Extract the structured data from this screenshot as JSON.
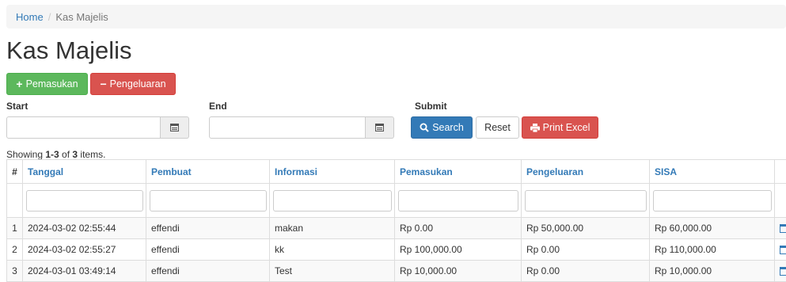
{
  "breadcrumb": {
    "home": "Home",
    "separator": "/",
    "current": "Kas Majelis"
  },
  "page": {
    "title": "Kas Majelis"
  },
  "actions": {
    "pemasukan": "Pemasukan",
    "pengeluaran": "Pengeluaran"
  },
  "filters": {
    "start_label": "Start",
    "end_label": "End",
    "submit_label": "Submit",
    "start_value": "",
    "end_value": "",
    "search": "Search",
    "reset": "Reset",
    "print_excel": "Print Excel"
  },
  "summary": {
    "prefix": "Showing ",
    "range": "1-3",
    "middle": " of ",
    "total": "3",
    "suffix": " items."
  },
  "table": {
    "columns": [
      "#",
      "Tanggal",
      "Pembuat",
      "Informasi",
      "Pemasukan",
      "Pengeluaran",
      "SISA",
      ""
    ],
    "rows": [
      [
        "1",
        "2024-03-02 02:55:44",
        "effendi",
        "makan",
        "Rp 0.00",
        "Rp 50,000.00",
        "Rp 60,000.00"
      ],
      [
        "2",
        "2024-03-02 02:55:27",
        "effendi",
        "kk",
        "Rp 100,000.00",
        "Rp 0.00",
        "Rp 110,000.00"
      ],
      [
        "3",
        "2024-03-01 03:49:14",
        "effendi",
        "Test",
        "Rp 10,000.00",
        "Rp 0.00",
        "Rp 10,000.00"
      ]
    ]
  },
  "colors": {
    "primary": "#337ab7",
    "success": "#5cb85c",
    "danger": "#d9534f"
  },
  "icons": {
    "add": "plus-icon",
    "remove": "minus-icon",
    "calendar": "calendar-icon",
    "search": "search-icon",
    "print": "print-icon",
    "delete": "trash-icon"
  }
}
